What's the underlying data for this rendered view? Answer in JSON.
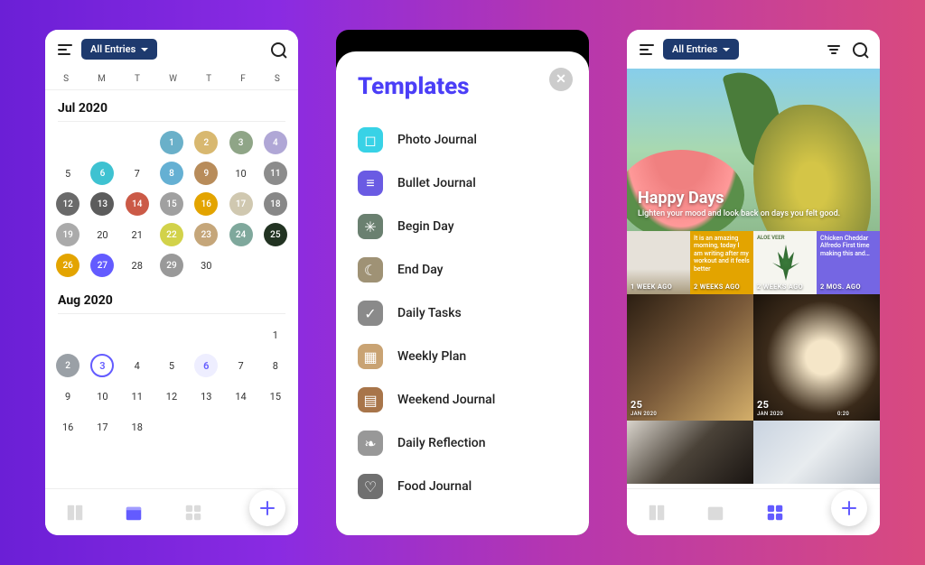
{
  "left": {
    "allEntries": "All Entries",
    "days": [
      "S",
      "M",
      "T",
      "W",
      "T",
      "F",
      "S"
    ],
    "jul": {
      "label": "Jul 2020",
      "cells": [
        {
          "n": "",
          "t": ""
        },
        {
          "n": "",
          "t": ""
        },
        {
          "n": "",
          "t": ""
        },
        {
          "n": "1",
          "t": "th",
          "c": "#6ab0c9"
        },
        {
          "n": "2",
          "t": "th",
          "c": "#d8b870"
        },
        {
          "n": "3",
          "t": "th",
          "c": "#8fa587"
        },
        {
          "n": "4",
          "t": "th",
          "c": "#b0a7d6"
        },
        {
          "n": "5",
          "t": "p"
        },
        {
          "n": "6",
          "t": "th",
          "c": "#3ec2d1"
        },
        {
          "n": "7",
          "t": "p"
        },
        {
          "n": "8",
          "t": "th",
          "c": "#65b0d3"
        },
        {
          "n": "9",
          "t": "th",
          "c": "#b88c5a"
        },
        {
          "n": "10",
          "t": "p"
        },
        {
          "n": "11",
          "t": "th",
          "c": "#8c8c8c"
        },
        {
          "n": "12",
          "t": "th",
          "c": "#6a6a6a"
        },
        {
          "n": "13",
          "t": "th",
          "c": "#5c5c5c"
        },
        {
          "n": "14",
          "t": "th",
          "c": "#cb5a47"
        },
        {
          "n": "15",
          "t": "th",
          "c": "#a0a0a0"
        },
        {
          "n": "16",
          "t": "th",
          "c": "#e3a400"
        },
        {
          "n": "17",
          "t": "th",
          "c": "#d0c8b0"
        },
        {
          "n": "18",
          "t": "th",
          "c": "#888"
        },
        {
          "n": "19",
          "t": "th",
          "c": "#aaa"
        },
        {
          "n": "20",
          "t": "p"
        },
        {
          "n": "21",
          "t": "p"
        },
        {
          "n": "22",
          "t": "th",
          "c": "#d2d24a"
        },
        {
          "n": "23",
          "t": "th",
          "c": "#c5a67a"
        },
        {
          "n": "24",
          "t": "th",
          "c": "#7fa89c"
        },
        {
          "n": "25",
          "t": "th",
          "c": "#223322"
        },
        {
          "n": "26",
          "t": "th",
          "c": "#e3a400"
        },
        {
          "n": "27",
          "t": "th",
          "c": "#635bff"
        },
        {
          "n": "28",
          "t": "p"
        },
        {
          "n": "29",
          "t": "th",
          "c": "#999"
        },
        {
          "n": "30",
          "t": "p"
        },
        {
          "n": "",
          "t": ""
        },
        {
          "n": "",
          "t": ""
        }
      ]
    },
    "aug": {
      "label": "Aug 2020",
      "rows": [
        [
          "",
          "",
          "",
          "",
          "",
          "",
          {
            "n": "1"
          }
        ],
        [
          {
            "n": "2",
            "t": "th",
            "c": "#9aa0a6"
          },
          {
            "n": "3",
            "t": "ring"
          },
          {
            "n": "4"
          },
          {
            "n": "5"
          },
          {
            "n": "6",
            "t": "today"
          },
          {
            "n": "7"
          },
          {
            "n": "8"
          }
        ],
        [
          {
            "n": "9"
          },
          {
            "n": "10"
          },
          {
            "n": "11"
          },
          {
            "n": "12"
          },
          {
            "n": "13"
          },
          {
            "n": "14"
          },
          {
            "n": "15"
          }
        ],
        [
          {
            "n": "16"
          },
          {
            "n": "17"
          },
          {
            "n": "18"
          },
          {
            "n": "",
            "t": ""
          },
          {
            "n": "",
            "t": ""
          },
          {
            "n": "",
            "t": ""
          },
          {
            "n": "",
            "t": ""
          }
        ]
      ]
    }
  },
  "mid": {
    "title": "Templates",
    "items": [
      {
        "label": "Photo Journal",
        "color": "#38d2e6",
        "glyph": "◻"
      },
      {
        "label": "Bullet Journal",
        "color": "#6a5be3",
        "glyph": "≡"
      },
      {
        "label": "Begin Day",
        "color": "#6a8070",
        "glyph": "✳"
      },
      {
        "label": "End Day",
        "color": "#9f9275",
        "glyph": "☾"
      },
      {
        "label": "Daily Tasks",
        "color": "#8a8a8a",
        "glyph": "✓"
      },
      {
        "label": "Weekly Plan",
        "color": "#c9a373",
        "glyph": "▦"
      },
      {
        "label": "Weekend Journal",
        "color": "#a8754a",
        "glyph": "▤"
      },
      {
        "label": "Daily Reflection",
        "color": "#989898",
        "glyph": "❧"
      },
      {
        "label": "Food Journal",
        "color": "#707070",
        "glyph": "♡"
      }
    ]
  },
  "right": {
    "allEntries": "All Entries",
    "hero": {
      "title": "Happy Days",
      "sub": "Lighten your mood and look back on days you felt good."
    },
    "row1": [
      {
        "type": "img",
        "lab": "1 WEEK AGO",
        "bg": "linear-gradient(#e6e1d9 60%,#a89a7d)"
      },
      {
        "type": "txt",
        "lab": "2 WEEKS AGO",
        "bg": "#e3a400",
        "text": "It is an amazing morning, today I am writing after my workout and it feels better"
      },
      {
        "type": "img",
        "lab": "2 WEEKS AGO",
        "bg": "#f5f5ef",
        "text": "ALOE VEER"
      },
      {
        "type": "txt",
        "lab": "2 MOS. AGO",
        "bg": "#7566e3",
        "text": "Chicken Cheddar Alfredo First time making this and…"
      }
    ],
    "row2": [
      {
        "lab": "25",
        "sub": "JAN 2020",
        "bg": "linear-gradient(135deg,#2b1e12,#7a5a3a,#d4af6a)"
      },
      {
        "lab": "25",
        "sub": "JAN 2020",
        "sub2": "0:20",
        "bg": "radial-gradient(circle at 55% 50%,#f5e6c8 18%,#3a2a1a 60%,#1a120a)"
      }
    ],
    "row3": [
      {
        "bg": "linear-gradient(135deg,#d9d4cc,#4a4238,#1a1512)"
      },
      {
        "bg": "linear-gradient(135deg,#c9d3e0,#e8ecef,#b0b8c2)"
      }
    ]
  }
}
